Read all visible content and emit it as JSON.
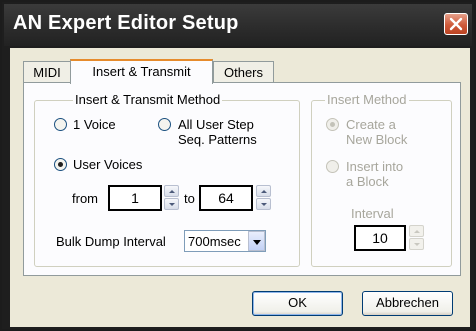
{
  "window": {
    "title": "AN Expert Editor Setup"
  },
  "tabs": [
    {
      "label": "MIDI"
    },
    {
      "label": "Insert & Transmit"
    },
    {
      "label": "Others"
    }
  ],
  "transmit_group": {
    "legend": "Insert & Transmit Method",
    "radio_1voice": "1 Voice",
    "radio_userstep_line1": "All User Step",
    "radio_userstep_line2": "Seq. Patterns",
    "radio_uservoices": "User Voices",
    "from_label": "from",
    "from_value": "1",
    "to_label": "to",
    "to_value": "64",
    "bulk_label": "Bulk Dump Interval",
    "bulk_value": "700msec"
  },
  "insert_group": {
    "legend": "Insert Method",
    "radio_create_line1": "Create a",
    "radio_create_line2": "New Block",
    "radio_insert_line1": "Insert into",
    "radio_insert_line2": "a Block",
    "interval_label": "Interval",
    "interval_value": "10"
  },
  "buttons": {
    "ok": "OK",
    "cancel": "Abbrechen"
  },
  "colors": {
    "titlebar": "#2b2b2b",
    "close": "#cf5a3a",
    "tab_highlight": "#e68b2c",
    "radio_dot": "#21a121"
  }
}
